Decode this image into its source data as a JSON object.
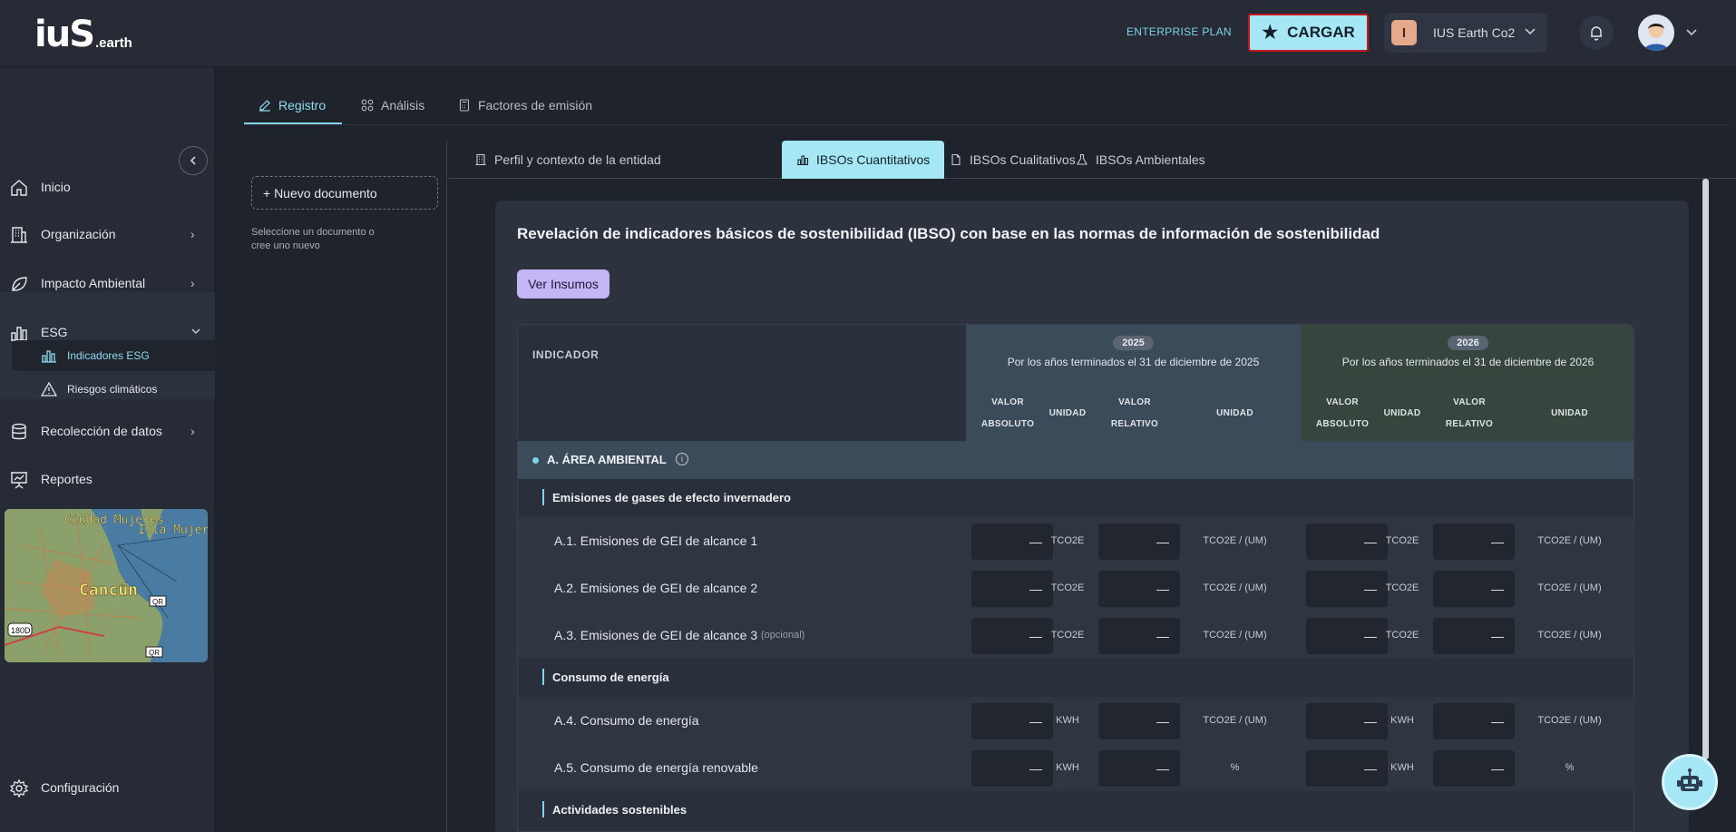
{
  "header": {
    "logo_main": "iuS",
    "logo_suffix": ".earth",
    "plan_label": "ENTERPRISE PLAN",
    "cargar_label": "CARGAR",
    "org_badge": "I",
    "org_name": "IUS Earth Co2"
  },
  "sidebar": {
    "items": [
      {
        "label": "Inicio"
      },
      {
        "label": "Organización"
      },
      {
        "label": "Impacto Ambiental"
      },
      {
        "label": "ESG"
      },
      {
        "label": "Recolección de datos"
      },
      {
        "label": "Reportes"
      },
      {
        "label": "Configuración"
      }
    ],
    "esg_sub": [
      {
        "label": "Indicadores ESG"
      },
      {
        "label": "Riesgos climáticos"
      }
    ],
    "map": {
      "labels": [
        "Ciudad Mujeres",
        "Isla Mujer",
        "Cancún"
      ],
      "shields": [
        "QR",
        "QR",
        "180D"
      ]
    }
  },
  "tabs": [
    {
      "label": "Registro"
    },
    {
      "label": "Análisis"
    },
    {
      "label": "Factores de emisión"
    }
  ],
  "left_panel": {
    "new_doc": "+ Nuevo documento",
    "hint": "Seleccione un documento o cree uno nuevo"
  },
  "subtabs": [
    {
      "label": "Perfil y contexto de la entidad"
    },
    {
      "label": "IBSOs Cuantitativos"
    },
    {
      "label": "IBSOs Cualitativos"
    },
    {
      "label": "IBSOs Ambientales"
    }
  ],
  "card": {
    "title": "Revelación de indicadores básicos de sostenibilidad (IBSO) con base en las normas de información de sostenibilidad",
    "insumos_label": "Ver Insumos"
  },
  "table": {
    "indicator_header": "INDICADOR",
    "years": [
      {
        "year": "2025",
        "desc": "Por los años terminados el 31 de diciembre de 2025"
      },
      {
        "year": "2026",
        "desc": "Por los años terminados el 31 de diciembre de 2026"
      }
    ],
    "col_headers": {
      "valor_absoluto_1": "VALOR",
      "valor_absoluto_2": "ABSOLUTO",
      "unidad": "UNIDAD",
      "valor_relativo_1": "VALOR",
      "valor_relativo_2": "RELATIVO"
    },
    "section": "A. ÁREA AMBIENTAL",
    "groups": [
      {
        "title": "Emisiones de gases de efecto invernadero"
      },
      {
        "title": "Consumo de energía"
      },
      {
        "title": "Actividades sostenibles"
      }
    ],
    "rows": [
      {
        "label": "A.1. Emisiones de GEI de alcance 1",
        "optional": "",
        "abs": "—",
        "unit_abs": "TCO2E",
        "rel": "—",
        "unit_rel": "TCO2E / (UM)",
        "abs2": "—",
        "unit_abs2": "TCO2E",
        "rel2": "—",
        "unit_rel2": "TCO2E / (UM)"
      },
      {
        "label": "A.2. Emisiones de GEI de alcance 2",
        "optional": "",
        "abs": "—",
        "unit_abs": "TCO2E",
        "rel": "—",
        "unit_rel": "TCO2E / (UM)",
        "abs2": "—",
        "unit_abs2": "TCO2E",
        "rel2": "—",
        "unit_rel2": "TCO2E / (UM)"
      },
      {
        "label": "A.3. Emisiones de GEI de alcance 3",
        "optional": "(opcional)",
        "abs": "—",
        "unit_abs": "TCO2E",
        "rel": "—",
        "unit_rel": "TCO2E / (UM)",
        "abs2": "—",
        "unit_abs2": "TCO2E",
        "rel2": "—",
        "unit_rel2": "TCO2E / (UM)"
      },
      {
        "label": "A.4. Consumo de energía",
        "optional": "",
        "abs": "—",
        "unit_abs": "KWH",
        "rel": "—",
        "unit_rel": "TCO2E / (UM)",
        "abs2": "—",
        "unit_abs2": "KWH",
        "rel2": "—",
        "unit_rel2": "TCO2E / (UM)"
      },
      {
        "label": "A.5. Consumo de energía renovable",
        "optional": "",
        "abs": "—",
        "unit_abs": "KWH",
        "rel": "—",
        "unit_rel": "%",
        "abs2": "—",
        "unit_abs2": "KWH",
        "rel2": "—",
        "unit_rel2": "%"
      }
    ]
  }
}
